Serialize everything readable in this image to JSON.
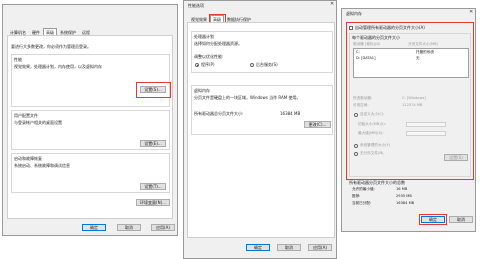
{
  "dialog1": {
    "tabs": [
      "计算机名",
      "硬件",
      "高级",
      "系统保护",
      "远程"
    ],
    "admin_note": "要进行大多数更改，你必须作为管理员登录。",
    "performance": {
      "title": "性能",
      "desc": "视觉效果，处理器计划，内存使用，以及虚拟内存",
      "button": "设置(S)..."
    },
    "user_profiles": {
      "title": "用户配置文件",
      "desc": "与登录帐户相关的桌面设置",
      "button": "设置(E)..."
    },
    "startup_recovery": {
      "title": "启动和故障恢复",
      "desc": "系统启动、系统故障和调试信息",
      "button": "设置(T)..."
    },
    "env_button": "环境变量(N)...",
    "ok": "确定",
    "cancel": "取消",
    "apply": "应用(A)"
  },
  "dialog2": {
    "title": "性能选项",
    "tabs": [
      "视觉效果",
      "高级",
      "数据执行保护"
    ],
    "scheduling": {
      "title": "处理器计划",
      "desc": "选择如何分配处理器资源。",
      "adjust": "调整以优化性能:",
      "opt_programs": "程序(P)",
      "opt_services": "后台服务(S)"
    },
    "vm": {
      "title": "虚拟内存",
      "desc": "分页文件是硬盘上的一块区域，Windows 当作 RAM 使用。",
      "total_label": "所有驱动器总分页文件大小:",
      "total_value": "16384 MB",
      "button": "更改(C)..."
    },
    "ok": "确定",
    "cancel": "取消",
    "apply": "应用(A)"
  },
  "dialog3": {
    "title": "虚拟内存",
    "auto_manage": "自动管理所有驱动器的分页文件大小(A)",
    "per_drive_title": "每个驱动器的分页文件大小",
    "col_drive": "驱动器 [卷标](D)",
    "col_size": "分页文件大小(MB)",
    "drives": [
      {
        "drive": "C:",
        "size": "托管的系统"
      },
      {
        "drive": "D:      [DATA1]",
        "size": "无"
      }
    ],
    "selected_drive_label": "所选驱动器:",
    "selected_drive_value": "C: [Windows]",
    "free_space_label": "可用空间:",
    "free_space_value": "112574 MB",
    "custom_size": "自定义大小(C):",
    "initial_size": "初始大小(MB)(I):",
    "max_size": "最大值(MB)(X):",
    "system_managed": "系统管理的大小(Y)",
    "no_paging": "无分页文件(N)",
    "set_button": "设置(S)",
    "total_title": "所有驱动器分页文件大小的总数",
    "min_label": "允许的最小值:",
    "min_value": "16 MB",
    "rec_label": "推荐:",
    "rec_value": "2935 MB",
    "cur_label": "当前已分配:",
    "cur_value": "16384 MB",
    "ok": "确定",
    "cancel": "取消"
  }
}
